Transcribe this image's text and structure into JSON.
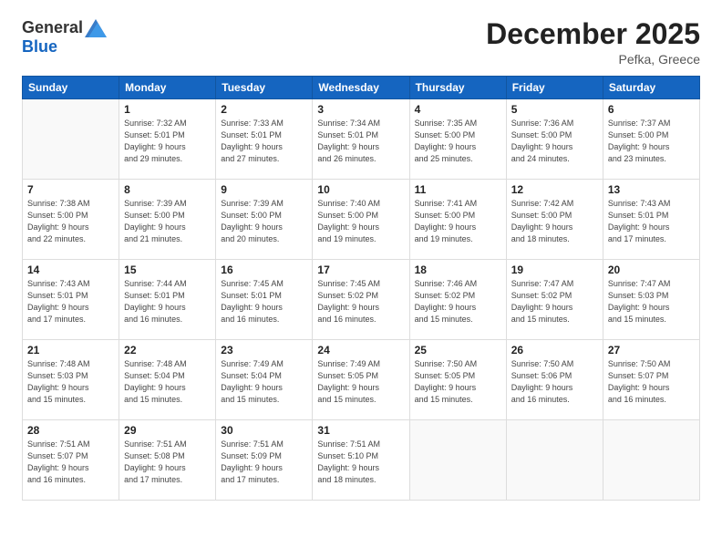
{
  "header": {
    "logo_general": "General",
    "logo_blue": "Blue",
    "title": "December 2025",
    "location": "Pefka, Greece"
  },
  "weekdays": [
    "Sunday",
    "Monday",
    "Tuesday",
    "Wednesday",
    "Thursday",
    "Friday",
    "Saturday"
  ],
  "weeks": [
    [
      {
        "day": "",
        "info": ""
      },
      {
        "day": "1",
        "info": "Sunrise: 7:32 AM\nSunset: 5:01 PM\nDaylight: 9 hours\nand 29 minutes."
      },
      {
        "day": "2",
        "info": "Sunrise: 7:33 AM\nSunset: 5:01 PM\nDaylight: 9 hours\nand 27 minutes."
      },
      {
        "day": "3",
        "info": "Sunrise: 7:34 AM\nSunset: 5:01 PM\nDaylight: 9 hours\nand 26 minutes."
      },
      {
        "day": "4",
        "info": "Sunrise: 7:35 AM\nSunset: 5:00 PM\nDaylight: 9 hours\nand 25 minutes."
      },
      {
        "day": "5",
        "info": "Sunrise: 7:36 AM\nSunset: 5:00 PM\nDaylight: 9 hours\nand 24 minutes."
      },
      {
        "day": "6",
        "info": "Sunrise: 7:37 AM\nSunset: 5:00 PM\nDaylight: 9 hours\nand 23 minutes."
      }
    ],
    [
      {
        "day": "7",
        "info": "Sunrise: 7:38 AM\nSunset: 5:00 PM\nDaylight: 9 hours\nand 22 minutes."
      },
      {
        "day": "8",
        "info": "Sunrise: 7:39 AM\nSunset: 5:00 PM\nDaylight: 9 hours\nand 21 minutes."
      },
      {
        "day": "9",
        "info": "Sunrise: 7:39 AM\nSunset: 5:00 PM\nDaylight: 9 hours\nand 20 minutes."
      },
      {
        "day": "10",
        "info": "Sunrise: 7:40 AM\nSunset: 5:00 PM\nDaylight: 9 hours\nand 19 minutes."
      },
      {
        "day": "11",
        "info": "Sunrise: 7:41 AM\nSunset: 5:00 PM\nDaylight: 9 hours\nand 19 minutes."
      },
      {
        "day": "12",
        "info": "Sunrise: 7:42 AM\nSunset: 5:00 PM\nDaylight: 9 hours\nand 18 minutes."
      },
      {
        "day": "13",
        "info": "Sunrise: 7:43 AM\nSunset: 5:01 PM\nDaylight: 9 hours\nand 17 minutes."
      }
    ],
    [
      {
        "day": "14",
        "info": "Sunrise: 7:43 AM\nSunset: 5:01 PM\nDaylight: 9 hours\nand 17 minutes."
      },
      {
        "day": "15",
        "info": "Sunrise: 7:44 AM\nSunset: 5:01 PM\nDaylight: 9 hours\nand 16 minutes."
      },
      {
        "day": "16",
        "info": "Sunrise: 7:45 AM\nSunset: 5:01 PM\nDaylight: 9 hours\nand 16 minutes."
      },
      {
        "day": "17",
        "info": "Sunrise: 7:45 AM\nSunset: 5:02 PM\nDaylight: 9 hours\nand 16 minutes."
      },
      {
        "day": "18",
        "info": "Sunrise: 7:46 AM\nSunset: 5:02 PM\nDaylight: 9 hours\nand 15 minutes."
      },
      {
        "day": "19",
        "info": "Sunrise: 7:47 AM\nSunset: 5:02 PM\nDaylight: 9 hours\nand 15 minutes."
      },
      {
        "day": "20",
        "info": "Sunrise: 7:47 AM\nSunset: 5:03 PM\nDaylight: 9 hours\nand 15 minutes."
      }
    ],
    [
      {
        "day": "21",
        "info": "Sunrise: 7:48 AM\nSunset: 5:03 PM\nDaylight: 9 hours\nand 15 minutes."
      },
      {
        "day": "22",
        "info": "Sunrise: 7:48 AM\nSunset: 5:04 PM\nDaylight: 9 hours\nand 15 minutes."
      },
      {
        "day": "23",
        "info": "Sunrise: 7:49 AM\nSunset: 5:04 PM\nDaylight: 9 hours\nand 15 minutes."
      },
      {
        "day": "24",
        "info": "Sunrise: 7:49 AM\nSunset: 5:05 PM\nDaylight: 9 hours\nand 15 minutes."
      },
      {
        "day": "25",
        "info": "Sunrise: 7:50 AM\nSunset: 5:05 PM\nDaylight: 9 hours\nand 15 minutes."
      },
      {
        "day": "26",
        "info": "Sunrise: 7:50 AM\nSunset: 5:06 PM\nDaylight: 9 hours\nand 16 minutes."
      },
      {
        "day": "27",
        "info": "Sunrise: 7:50 AM\nSunset: 5:07 PM\nDaylight: 9 hours\nand 16 minutes."
      }
    ],
    [
      {
        "day": "28",
        "info": "Sunrise: 7:51 AM\nSunset: 5:07 PM\nDaylight: 9 hours\nand 16 minutes."
      },
      {
        "day": "29",
        "info": "Sunrise: 7:51 AM\nSunset: 5:08 PM\nDaylight: 9 hours\nand 17 minutes."
      },
      {
        "day": "30",
        "info": "Sunrise: 7:51 AM\nSunset: 5:09 PM\nDaylight: 9 hours\nand 17 minutes."
      },
      {
        "day": "31",
        "info": "Sunrise: 7:51 AM\nSunset: 5:10 PM\nDaylight: 9 hours\nand 18 minutes."
      },
      {
        "day": "",
        "info": ""
      },
      {
        "day": "",
        "info": ""
      },
      {
        "day": "",
        "info": ""
      }
    ]
  ]
}
